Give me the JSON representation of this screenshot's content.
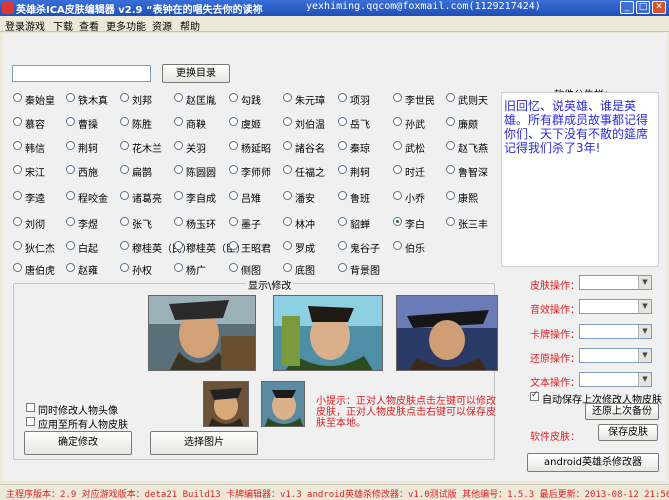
{
  "window": {
    "title": "英雄杀ICA皮肤编辑器 v2.9 “表钟在的唱失去你的读祢",
    "email": "yexhiming.qqcom@foxmail.com(1129217424)"
  },
  "menu": [
    "登录游戏",
    "下载",
    "查看",
    "更多功能",
    "资源",
    "帮助"
  ],
  "top": {
    "path_value": "",
    "change_dir_label": "更换目录"
  },
  "heroes": [
    [
      "秦始皇",
      "铁木真",
      "刘邦",
      "赵匡胤",
      "勾践",
      "朱元璋",
      "项羽",
      "李世民",
      "武则天"
    ],
    [
      "慕容",
      "曹操",
      "陈胜",
      "商鞅",
      "虞姬",
      "刘伯温",
      "岳飞",
      "孙武",
      "廉颇"
    ],
    [
      "韩信",
      "荆轲",
      "花木兰",
      "关羽",
      "杨延昭",
      "諸谷名",
      "秦琼",
      "武松",
      "赵飞燕"
    ],
    [
      "宋江",
      "西施",
      "扁鹊",
      "陈圆圆",
      "李师师",
      "任福之",
      "荆轲",
      "时迁",
      "鲁智深"
    ],
    [
      "李逵",
      "程咬金",
      "诸葛亮",
      "李自成",
      "吕雉",
      "潘安",
      "鲁班",
      "小乔",
      "康熙"
    ],
    [
      "刘彻",
      "李煜",
      "张飞",
      "杨玉环",
      "墨子",
      "林冲",
      "貂蝉",
      "李白",
      "张三丰"
    ],
    [
      "狄仁杰",
      "白起",
      "穆桂英（民）",
      "穆桂英（臣）",
      "王昭君",
      "罗成",
      "鬼谷子",
      "伯乐"
    ],
    [
      "唐伯虎",
      "赵雍",
      "孙权",
      "杨广",
      "侧图",
      "底图",
      "背景图"
    ]
  ],
  "selected_hero": "李白",
  "notice": {
    "title": "软件公告栏：",
    "text": "旧回忆、说英雄、谁是英雄。所有群成员故事都记得你们、天下没有不散的筵席记得我们杀了3年!"
  },
  "display": {
    "title": "显示\\修改",
    "hint_label": "小提示：",
    "hint_text": "正对人物皮肤点击左键可以修改皮肤，正对人物皮肤点击右键可以保存皮肤至本地。",
    "check_sync_avatar": "同时修改人物头像",
    "check_apply_all": "应用至所有人物皮肤",
    "confirm_label": "确定修改",
    "select_image_label": "选择图片"
  },
  "side": {
    "ops": [
      "皮肤操作：",
      "音效操作：",
      "卡牌操作：",
      "还原操作：",
      "文本操作："
    ],
    "auto_save_label": "自动保存上次修改人物皮肤",
    "restore_backup_label": "还原上次备份",
    "skin_label": "软件皮肤：",
    "save_skin_label": "保存皮肤",
    "android_label": "android英雄杀修改器"
  },
  "status": "主程序版本：2.9 对应游戏版本：deta21 Build13 卡牌编辑器：v1.3 android英雄杀修改器：v1.0测试版 其他编号：1.5.3 最后更新：2013-08-12 21:56:12",
  "colors": {
    "titlebar": "#1f4fb6",
    "hint_red": "#d22",
    "notice_blue": "#2b2bdc"
  }
}
